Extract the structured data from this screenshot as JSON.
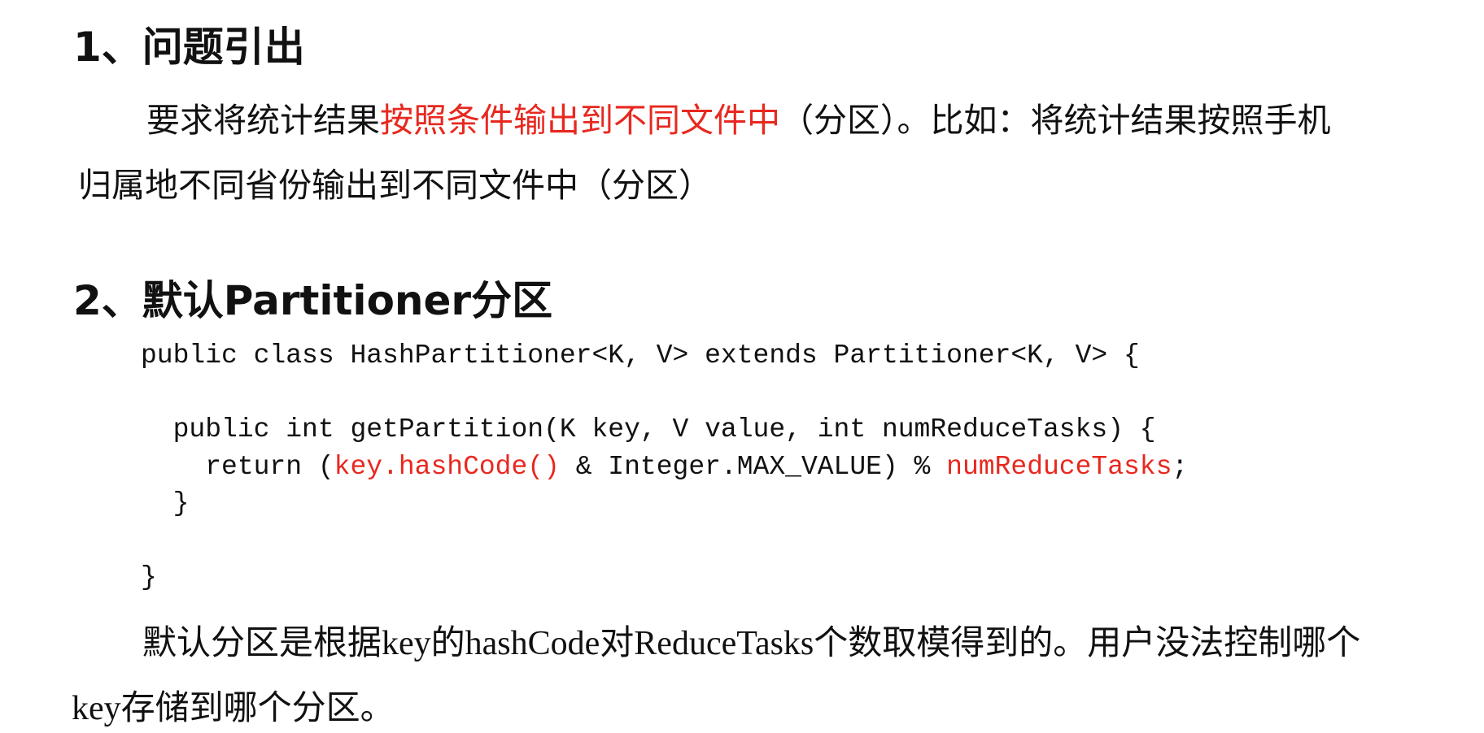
{
  "section1": {
    "heading": "1、问题引出",
    "para_line1_prefix": "要求将统计结果",
    "para_line1_highlight": "按照条件输出到不同文件中",
    "para_line1_suffix": "（分区）。比如：将统计结果按照手机",
    "para_line2": "归属地不同省份输出到不同文件中（分区）"
  },
  "section2": {
    "heading": "2、默认Partitioner分区",
    "code": {
      "line1": "public class HashPartitioner<K, V> extends Partitioner<K, V> {",
      "line3": "  public int getPartition(K key, V value, int numReduceTasks) {",
      "line4_pre": "    return (",
      "line4_hl1": "key.hashCode()",
      "line4_mid": " & Integer.MAX_VALUE) % ",
      "line4_hl2": "numReduceTasks",
      "line4_post": ";",
      "line5": "  }",
      "line7": "}"
    },
    "para_line1": "默认分区是根据key的hashCode对ReduceTasks个数取模得到的。用户没法控制哪个",
    "para_line2": "key存储到哪个分区。"
  },
  "colors": {
    "highlight": "#e8281f",
    "text": "#111111",
    "background": "#ffffff"
  }
}
